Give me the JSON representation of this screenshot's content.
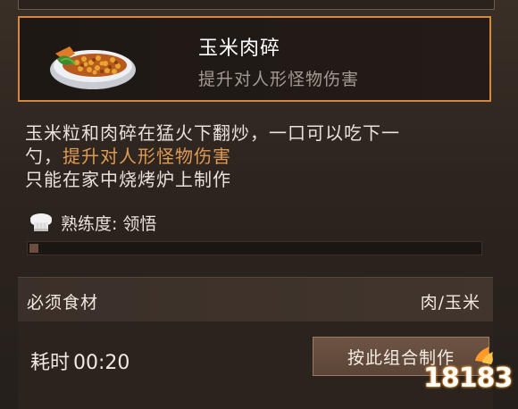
{
  "item": {
    "name": "玉米肉碎",
    "effect": "提升对人形怪物伤害",
    "icon": "corn-minced-meat-dish-icon"
  },
  "description": {
    "line1": "玉米粒和肉碎在猛火下翻炒，一口可以吃下一",
    "line2_prefix": "勺，",
    "line2_highlight": "提升对人形怪物伤害",
    "line3": "只能在家中烧烤炉上制作"
  },
  "proficiency": {
    "label": "熟练度:",
    "value": "领悟",
    "progress": 0.02,
    "icon": "chef-hat-icon"
  },
  "ingredients": {
    "label": "必须食材",
    "value": "肉/玉米"
  },
  "crafting": {
    "time_label": "耗时",
    "time_value": "00:20",
    "button_label": "按此组合制作"
  },
  "watermark": {
    "text": "18183"
  },
  "colors": {
    "accent_border": "#d6893e",
    "highlight_text": "#e09a55",
    "button_bg": "#5b4537"
  }
}
